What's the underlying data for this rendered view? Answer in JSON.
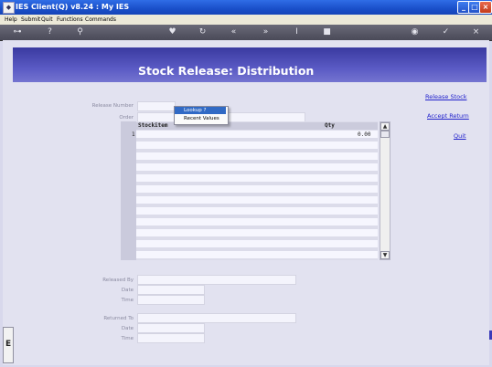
{
  "window": {
    "title": "IES Client(Q) v8.24 : My IES",
    "controls": [
      "_",
      "□",
      "×"
    ]
  },
  "menu": [
    "Help",
    "Submit",
    "Quit",
    "Functions",
    "Commands"
  ],
  "toolbar": {
    "icons": [
      "key-icon",
      "help-icon",
      "search-icon",
      "heart-icon",
      "power-icon",
      "rewind-icon",
      "forward-icon",
      "text-cursor-icon",
      "stop-icon",
      "globe-icon",
      "check-icon",
      "close-icon"
    ]
  },
  "form": {
    "title": "Stock Release: Distribution",
    "fields": {
      "release_number": "Release Number",
      "order": "Order",
      "released_by": "Released By",
      "date1": "Date",
      "time1": "Time",
      "returned_to": "Returned To",
      "date2": "Date",
      "time2": "Time"
    },
    "links": {
      "release_stock": "Release Stock",
      "accept_return": "Accept Return",
      "quit": "Quit"
    },
    "grid": {
      "columns": [
        "Stockitem",
        "Qty"
      ],
      "rows": [
        {
          "num": "1",
          "stockitem": "",
          "qty": "0.00"
        }
      ]
    },
    "popup": {
      "items": [
        "Lookup ?",
        "Recent Values"
      ]
    }
  },
  "left_panel": {
    "glyph": "E"
  }
}
